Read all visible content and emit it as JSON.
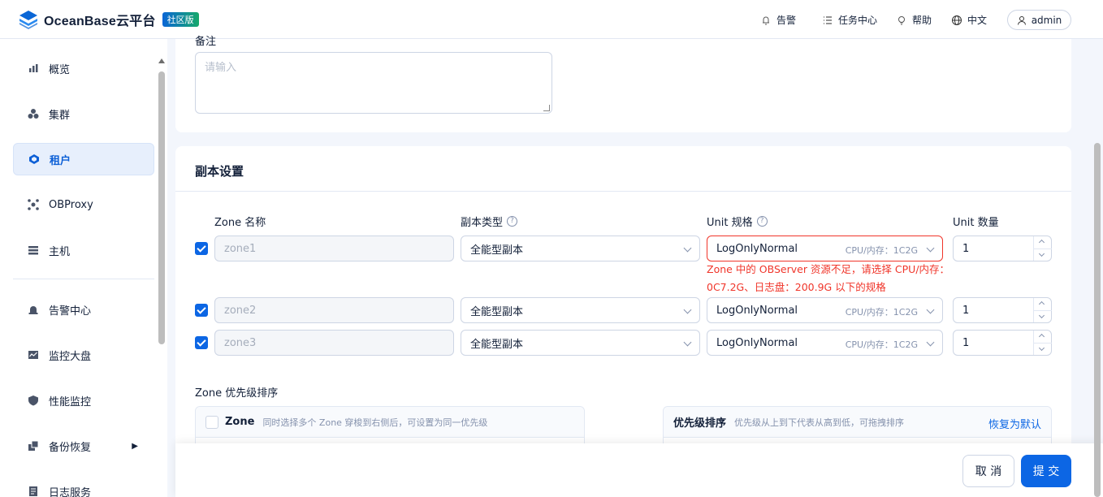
{
  "header": {
    "brand": "OceanBase云平台",
    "edition_badge": "社区版",
    "alerts": "告警",
    "tasks": "任务中心",
    "help": "帮助",
    "language": "中文",
    "user": "admin"
  },
  "sidebar": {
    "items": [
      {
        "label": "概览",
        "icon": "bar-chart-icon"
      },
      {
        "label": "集群",
        "icon": "cluster-icon"
      },
      {
        "label": "租户",
        "icon": "tenant-icon"
      },
      {
        "label": "OBProxy",
        "icon": "proxy-icon"
      },
      {
        "label": "主机",
        "icon": "host-icon"
      },
      {
        "label": "告警中心",
        "icon": "alarm-icon"
      },
      {
        "label": "监控大盘",
        "icon": "monitor-icon"
      },
      {
        "label": "性能监控",
        "icon": "shield-icon"
      },
      {
        "label": "备份恢复",
        "icon": "backup-icon"
      },
      {
        "label": "日志服务",
        "icon": "log-icon"
      }
    ]
  },
  "remark": {
    "label": "备注",
    "placeholder": "请输入"
  },
  "replica": {
    "title": "副本设置",
    "columns": {
      "zone": "Zone 名称",
      "type": "副本类型",
      "unit": "Unit 规格",
      "count": "Unit 数量"
    },
    "rows": [
      {
        "zone": "zone1",
        "type": "全能型副本",
        "unit": "LogOnlyNormal",
        "spec": "CPU/内存：1C2G",
        "count": "1"
      },
      {
        "zone": "zone2",
        "type": "全能型副本",
        "unit": "LogOnlyNormal",
        "spec": "CPU/内存：1C2G",
        "count": "1"
      },
      {
        "zone": "zone3",
        "type": "全能型副本",
        "unit": "LogOnlyNormal",
        "spec": "CPU/内存：1C2G",
        "count": "1"
      }
    ],
    "error": "Zone 中的 OBServer 资源不足，请选择 CPU/内存：0C7.2G、日志盘：200.9G 以下的规格"
  },
  "priority": {
    "label": "Zone 优先级排序",
    "left_title": "Zone",
    "left_hint": "同时选择多个 Zone 穿梭到右侧后，可设置为同一优先级",
    "right_title": "优先级排序",
    "right_hint": "优先级从上到下代表从高到低，可拖拽排序",
    "reset": "恢复为默认"
  },
  "footer": {
    "cancel": "取 消",
    "submit": "提 交"
  },
  "colors": {
    "primary": "#0c66e4",
    "error": "#f0352a"
  }
}
